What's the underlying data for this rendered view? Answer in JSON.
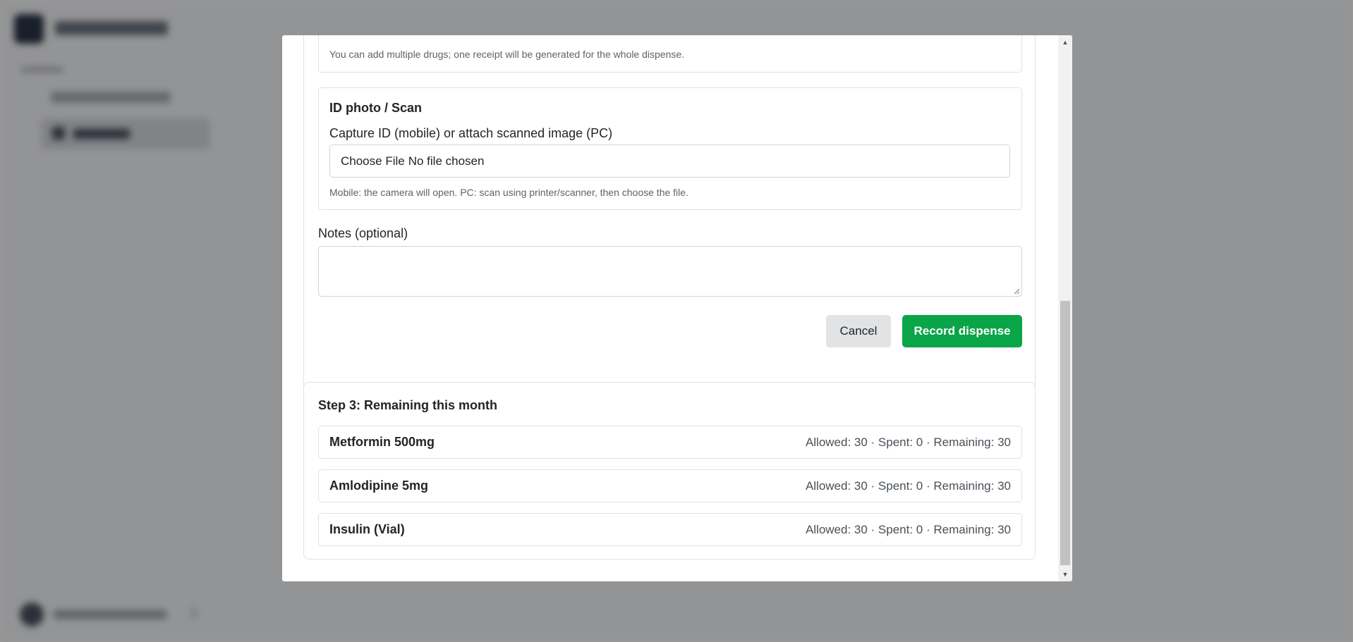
{
  "drug_section": {
    "hint": "You can add multiple drugs; one receipt will be generated for the whole dispense."
  },
  "id_photo": {
    "title": "ID photo / Scan",
    "label": "Capture ID (mobile) or attach scanned image (PC)",
    "file_button": "Choose File",
    "file_status": "No file chosen",
    "hint": "Mobile: the camera will open. PC: scan using printer/scanner, then choose the file."
  },
  "notes": {
    "label": "Notes (optional)",
    "value": ""
  },
  "actions": {
    "cancel_label": "Cancel",
    "submit_label": "Record dispense"
  },
  "remaining": {
    "title": "Step 3: Remaining this month",
    "items": [
      {
        "name": "Metformin 500mg",
        "stats": "Allowed: 30 · Spent: 0 · Remaining: 30"
      },
      {
        "name": "Amlodipine 5mg",
        "stats": "Allowed: 30 · Spent: 0 · Remaining: 30"
      },
      {
        "name": "Insulin (Vial)",
        "stats": "Allowed: 30 · Spent: 0 · Remaining: 30"
      }
    ]
  },
  "colors": {
    "primary_button": "#0aa548",
    "cancel_button": "#e2e3e5",
    "backdrop": "rgba(0,0,0,0.4)"
  },
  "icons": {
    "scroll_up": "triangle-up-icon",
    "scroll_down": "triangle-down-icon",
    "resize": "resize-grip-icon"
  }
}
